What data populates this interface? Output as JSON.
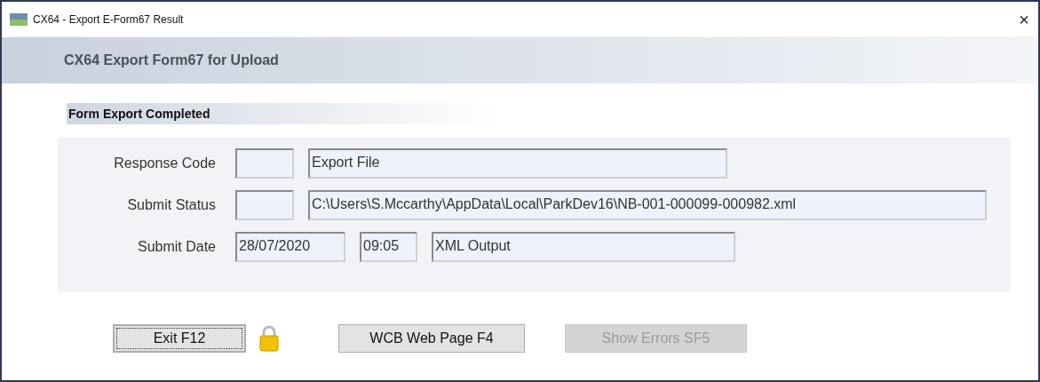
{
  "window": {
    "title": "CX64 - Export E-Form67 Result",
    "close": "×"
  },
  "header": {
    "title": "CX64  Export Form67 for Upload"
  },
  "section": {
    "title": "Form Export Completed"
  },
  "rows": [
    {
      "label": "Response Code",
      "fields": [
        {
          "kind": "code"
        },
        {
          "kind": "text",
          "value": "Export File"
        }
      ]
    },
    {
      "label": "Submit Status",
      "fields": [
        {
          "kind": "code"
        },
        {
          "kind": "path",
          "value": "C:\\Users\\S.Mccarthy\\AppData\\Local\\ParkDev16\\NB-001-000099-000982.xml"
        }
      ]
    },
    {
      "label": "Submit Date",
      "fields": [
        {
          "kind": "date",
          "value": "28/07/2020"
        },
        {
          "kind": "time",
          "value": "09:05"
        },
        {
          "kind": "output",
          "value": "XML Output"
        }
      ]
    }
  ],
  "buttons": [
    {
      "label": "Exit  F12",
      "focused": true,
      "disabled": false
    },
    {
      "label": "WCB Web Page  F4",
      "focused": false,
      "disabled": false
    },
    {
      "label": "Show Errors  SF5",
      "focused": false,
      "disabled": true
    }
  ]
}
